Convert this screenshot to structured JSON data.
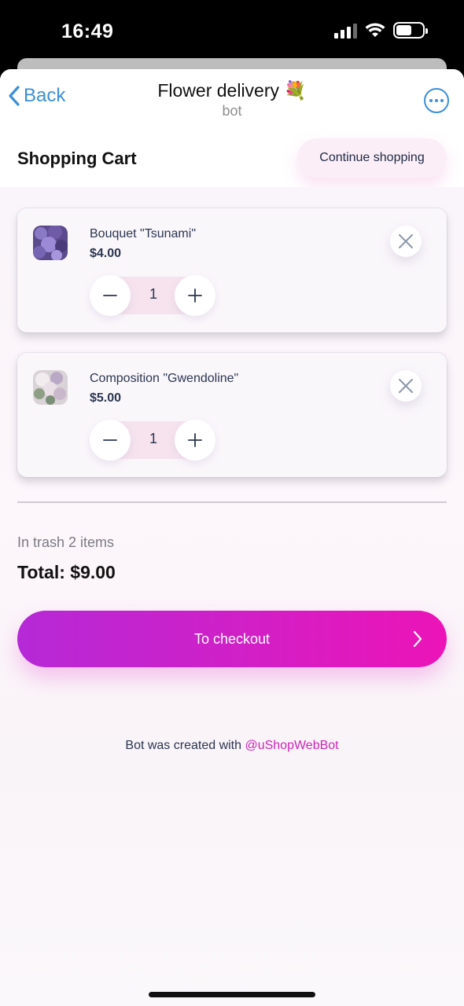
{
  "status": {
    "time": "16:49",
    "icons": [
      "signal-icon",
      "wifi-icon",
      "battery-icon"
    ]
  },
  "nav": {
    "back_label": "Back",
    "title": "Flower delivery",
    "title_emoji": "💐",
    "subtitle": "bot"
  },
  "cart": {
    "title": "Shopping Cart",
    "continue_label": "Continue shopping",
    "items": [
      {
        "name": "Bouquet \"Tsunami\"",
        "price": "$4.00",
        "qty": "1"
      },
      {
        "name": "Composition \"Gwendoline\"",
        "price": "$5.00",
        "qty": "1"
      }
    ],
    "count_text": "In trash 2 items",
    "total_text": "Total: $9.00",
    "checkout_label": "To checkout"
  },
  "footer": {
    "prefix": "Bot was created with ",
    "link": "@uShopWebBot"
  },
  "colors": {
    "accent_blue": "#3b8fd6",
    "checkout_start": "#b529d6",
    "checkout_end": "#ec14b7",
    "link": "#cf23b8"
  }
}
